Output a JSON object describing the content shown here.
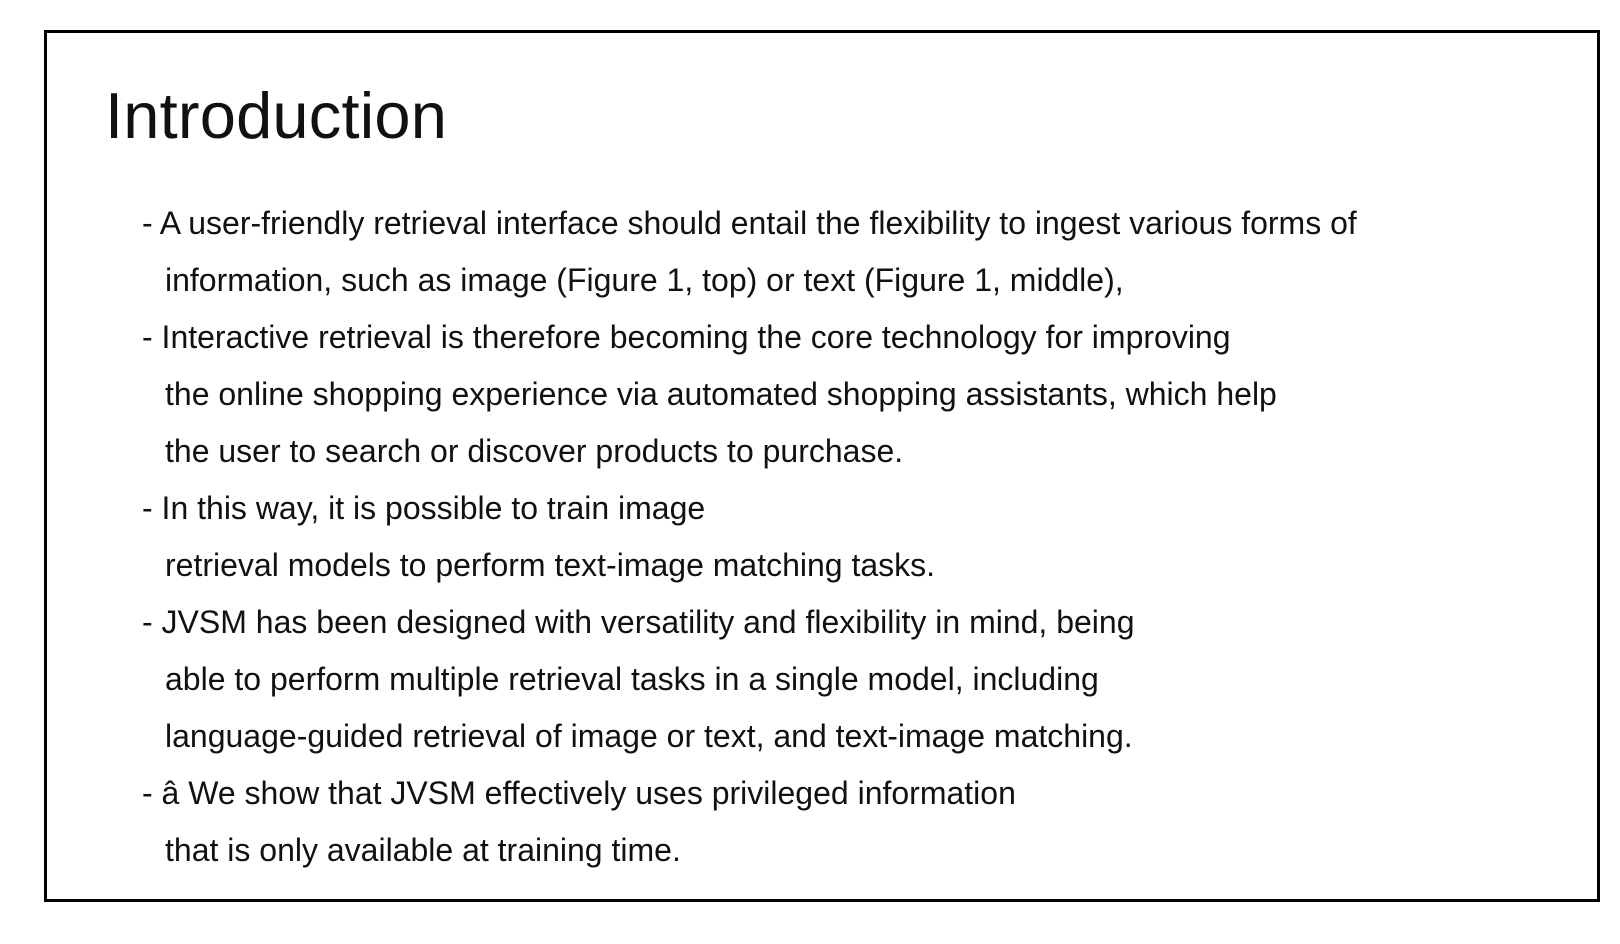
{
  "slide": {
    "title": "Introduction",
    "bullets": [
      {
        "lines": [
          "- A user-friendly retrieval interface should entail the flexibility to ingest various forms of",
          "information, such as image (Figure 1, top) or text (Figure 1, middle),"
        ]
      },
      {
        "lines": [
          "- Interactive retrieval is therefore becoming the core technology for improving",
          "the online shopping experience via automated shopping assistants, which help",
          "the user to search or discover products to purchase."
        ]
      },
      {
        "lines": [
          "- In this way, it is possible to train image",
          "retrieval models to perform text-image matching tasks."
        ]
      },
      {
        "lines": [
          "- JVSM has been designed with versatility and flexibility in mind, being",
          "able to perform multiple retrieval tasks in a single model, including",
          "language-guided retrieval of image or text, and text-image matching."
        ]
      },
      {
        "lines": [
          "- â We show that JVSM effectively uses privileged information",
          "that is only available at training time."
        ]
      }
    ]
  }
}
